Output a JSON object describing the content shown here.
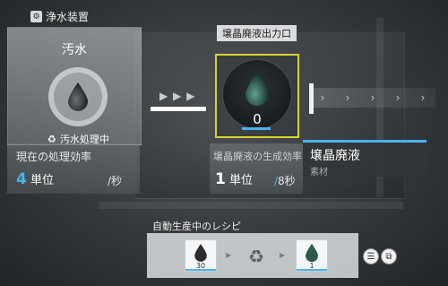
{
  "header": {
    "title": "浄水装置",
    "icon": "facility-icon"
  },
  "input_panel": {
    "item_name": "汚水",
    "status": "汚水処理中",
    "efficiency_label": "現在の処理効率",
    "efficiency_value": "4",
    "efficiency_unit": "単位",
    "per_sec": "/秒"
  },
  "output": {
    "label": "壌晶廃液出力口",
    "count": "0",
    "rate_label": "壌晶廃液の生成効率",
    "rate_value": "1",
    "rate_unit": "単位",
    "rate_slash": "/",
    "rate_per": "8秒"
  },
  "tooltip": {
    "name": "壌晶廃液",
    "subtitle": "素材"
  },
  "recipe": {
    "label": "自動生産中のレシピ",
    "input_count": "30",
    "output_count": "1"
  },
  "progress": {
    "input_fill": 0.95
  },
  "colors": {
    "accent_blue": "#49b4f2",
    "highlight_yellow": "#d8d233"
  }
}
